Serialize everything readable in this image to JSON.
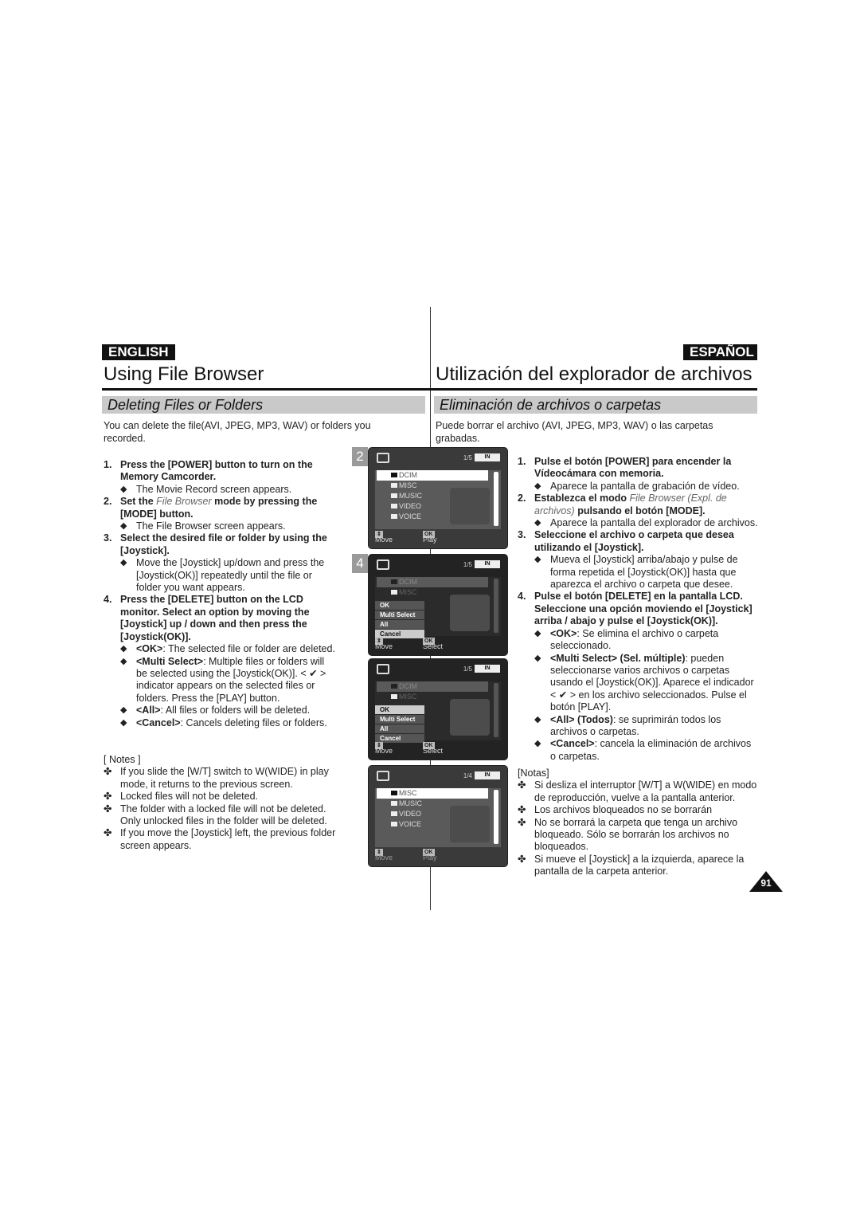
{
  "header": {
    "left_lang": "ENGLISH",
    "right_lang": "ESPAÑOL",
    "left_title": "Using File Browser",
    "right_title": "Utilización del explorador de archivos",
    "left_section": "Deleting Files or Folders",
    "right_section": "Eliminación de archivos o carpetas"
  },
  "left": {
    "intro": "You can delete the file(AVI, JPEG, MP3, WAV) or folders you recorded.",
    "steps": [
      {
        "num": "1.",
        "pre": "Press the [POWER] button to turn on the Memory Camcorder.",
        "em": "",
        "post": "",
        "bullets": [
          {
            "label": "",
            "text": "The Movie Record screen appears."
          }
        ]
      },
      {
        "num": "2.",
        "pre": "Set the ",
        "em": "File Browser",
        "post": " mode by pressing the [MODE] button.",
        "bullets": [
          {
            "label": "",
            "text": "The File Browser screen appears."
          }
        ]
      },
      {
        "num": "3.",
        "pre": "Select the desired file or folder by using the [Joystick].",
        "em": "",
        "post": "",
        "bullets": [
          {
            "label": "",
            "text": "Move the [Joystick] up/down and press the [Joystick(OK)] repeatedly until the file or folder you want appears."
          }
        ]
      },
      {
        "num": "4.",
        "pre": "Press the [DELETE] button on the LCD monitor. Select an option by moving the [Joystick] up / down and then press the [Joystick(OK)].",
        "em": "",
        "post": "",
        "bullets": [
          {
            "label": "<OK>",
            "text": ": The selected file or folder are deleted."
          },
          {
            "label": "<Multi Select>",
            "text": ": Multiple files or folders will be selected using the [Joystick(OK)]. < ✔ > indicator appears on the selected files or folders. Press the [PLAY] button."
          },
          {
            "label": "<All>",
            "text": ": All files or folders will be deleted."
          },
          {
            "label": "<Cancel>",
            "text": ": Cancels deleting files or folders."
          }
        ]
      }
    ],
    "notes_title": "[ Notes ]",
    "notes": [
      "If you slide the [W/T] switch to W(WIDE) in play mode, it returns to the previous screen.",
      "Locked files will not be deleted.",
      "The folder with a locked file will not be deleted. Only unlocked files in the folder will be deleted.",
      "If you move the [Joystick] left, the previous folder screen appears."
    ]
  },
  "right": {
    "intro": "Puede borrar el archivo (AVI, JPEG, MP3, WAV) o las carpetas grabadas.",
    "steps": [
      {
        "num": "1.",
        "pre": "Pulse el botón [POWER] para encender la Vídeocámara con memoria.",
        "em": "",
        "post": "",
        "bullets": [
          {
            "label": "",
            "text": "Aparece la pantalla de grabación de vídeo."
          }
        ]
      },
      {
        "num": "2.",
        "pre": "Establezca el modo ",
        "em": "File Browser (Expl. de archivos)",
        "post": " pulsando el botón [MODE].",
        "bullets": [
          {
            "label": "",
            "text": "Aparece la pantalla del explorador de archivos."
          }
        ]
      },
      {
        "num": "3.",
        "pre": "Seleccione el archivo o carpeta que desea utilizando el [Joystick].",
        "em": "",
        "post": "",
        "bullets": [
          {
            "label": "",
            "text": "Mueva el [Joystick] arriba/abajo y pulse de forma repetida el [Joystick(OK)] hasta que aparezca el archivo o carpeta que desee."
          }
        ]
      },
      {
        "num": "4.",
        "pre": "Pulse el botón [DELETE] en la pantalla LCD. Seleccione una opción moviendo el  [Joystick] arriba / abajo y pulse el [Joystick(OK)].",
        "em": "",
        "post": "",
        "bullets": [
          {
            "label": "<OK>",
            "text": ": Se elimina el archivo o carpeta seleccionado."
          },
          {
            "label": "<Multi Select> (Sel. múltiple)",
            "text": ": pueden seleccionarse varios archivos o carpetas usando el [Joystick(OK)]. Aparece el indicador < ✔ > en los archivo seleccionados. Pulse el botón [PLAY]."
          },
          {
            "label": "<All> (Todos)",
            "text": ": se suprimirán todos los archivos o carpetas."
          },
          {
            "label": "<Cancel>",
            "text": ": cancela la eliminación de archivos o carpetas."
          }
        ]
      }
    ],
    "notes_title": "[Notas]",
    "notes": [
      "Si desliza el interruptor [W/T] a W(WIDE) en modo de reproducción, vuelve a la pantalla anterior.",
      "Los archivos bloqueados no se borrarán",
      "No se borrará la carpeta que tenga un archivo bloqueado. Sólo se borrarán los archivos no bloqueados.",
      "Si mueve el [Joystick] a la izquierda, aparece la pantalla de la carpeta anterior."
    ]
  },
  "screens": [
    {
      "badge": "2",
      "counter": "1/5",
      "battery": "IN",
      "rows": [
        "DCIM",
        "MISC",
        "MUSIC",
        "VIDEO",
        "VOICE"
      ],
      "selected": 0,
      "menu": [],
      "move": "Move",
      "action": "Play",
      "ok_key": "OK"
    },
    {
      "badge": "4",
      "counter": "1/5",
      "battery": "IN",
      "rows": [
        "DCIM",
        "MISC"
      ],
      "selected": -1,
      "menu": [
        "OK",
        "Multi Select",
        "All",
        "Cancel"
      ],
      "menu_active": 3,
      "move": "Move",
      "action": "Select",
      "ok_key": "OK"
    },
    {
      "badge": "",
      "counter": "1/5",
      "battery": "IN",
      "rows": [
        "DCIM",
        "MISC"
      ],
      "selected": -1,
      "menu": [
        "OK",
        "Multi Select",
        "All",
        "Cancel"
      ],
      "menu_active": 0,
      "move": "Move",
      "action": "Select",
      "ok_key": "OK"
    },
    {
      "badge": "",
      "counter": "1/4",
      "battery": "IN",
      "rows": [
        "MISC",
        "MUSIC",
        "VIDEO",
        "VOICE"
      ],
      "selected": 0,
      "menu": [],
      "move": "Move",
      "action": "Play",
      "ok_key": "OK"
    }
  ],
  "page_number": "91",
  "icons": {
    "bullet": "◆",
    "note": "✤",
    "folder": "folder-icon"
  }
}
